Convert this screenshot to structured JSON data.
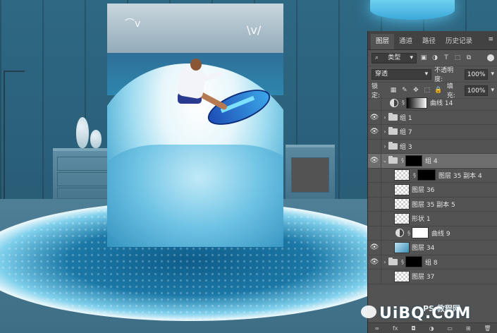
{
  "panel": {
    "tabs": [
      "图层",
      "通道",
      "路径",
      "历史记录"
    ],
    "menu_icon": "panel-menu-icon",
    "filter_kind": "类型",
    "blend_mode": "穿透",
    "opacity_label": "不透明度:",
    "opacity_value": "100%",
    "lock_label": "锁定:",
    "fill_label": "填充:",
    "fill_value": "100%",
    "layers": [
      {
        "name": "曲线 14",
        "visible": false,
        "type": "curves"
      },
      {
        "name": "组 1",
        "visible": true,
        "type": "group"
      },
      {
        "name": "组 7",
        "visible": true,
        "type": "group"
      },
      {
        "name": "组 3",
        "visible": false,
        "type": "group"
      },
      {
        "name": "组 4",
        "visible": true,
        "type": "group-open",
        "selected": true
      },
      {
        "name": "图层 35 副本 4",
        "visible": false,
        "type": "layer-mask"
      },
      {
        "name": "图层 36",
        "visible": false,
        "type": "layer"
      },
      {
        "name": "图层 35 副本 5",
        "visible": false,
        "type": "layer"
      },
      {
        "name": "形状 1",
        "visible": false,
        "type": "shape"
      },
      {
        "name": "曲线 9",
        "visible": false,
        "type": "curves-white"
      },
      {
        "name": "图层 34",
        "visible": true,
        "type": "layer"
      },
      {
        "name": "组 8",
        "visible": true,
        "type": "group-mask"
      },
      {
        "name": "图层 37",
        "visible": false,
        "type": "layer"
      }
    ],
    "bottom_icons": [
      "link-icon",
      "fx-icon",
      "mask-icon",
      "adjustment-icon",
      "folder-icon",
      "new-layer-icon",
      "trash-icon"
    ],
    "bottom_labels": [
      "∞",
      "fx",
      "◘",
      "◑",
      "▭",
      "⊞",
      "🗑"
    ]
  },
  "watermark": {
    "text": "UiBQ.CoM",
    "small_text": "PS 教程网"
  }
}
